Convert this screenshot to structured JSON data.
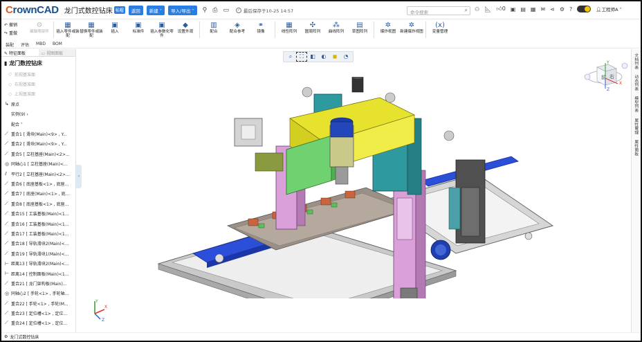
{
  "app": {
    "logo_first": "C",
    "logo_rest": "rownCAD",
    "doc_title": "龙门式数控钻床",
    "doc_tag": "帖帽"
  },
  "titlebar": {
    "btn_share": "返回",
    "btn_new": "新建 ˅",
    "btn_import_export": "导入/导出 ˅",
    "icon_pin": "pin-icon",
    "icon_print": "print-icon",
    "icon_save": "save-icon",
    "save_status": "最后保存于10-25 14:57",
    "search_placeholder": "命令搜索",
    "user_name": "工程师A ˅"
  },
  "ribbon": {
    "undo": "撤销",
    "redo": "重做",
    "items": [
      {
        "label": "编辑零部件",
        "icon": "⚙",
        "disabled": true
      },
      {
        "label": "插入零件或装配",
        "icon": "▦",
        "disabled": false
      },
      {
        "label": "替换零件或装配",
        "icon": "▦",
        "disabled": false
      },
      {
        "label": "插入",
        "icon": "▣",
        "disabled": false
      },
      {
        "label": "标准件",
        "icon": "▣",
        "disabled": false
      },
      {
        "label": "插入参数化零件",
        "icon": "▣",
        "disabled": false
      },
      {
        "label": "设置外观",
        "icon": "◆",
        "disabled": false
      },
      {
        "label": "配合",
        "icon": "▥",
        "disabled": false
      },
      {
        "label": "配合参考",
        "icon": "◈",
        "disabled": false
      },
      {
        "label": "镜像",
        "icon": "⚭",
        "disabled": false
      },
      {
        "label": "线性阵列",
        "icon": "▦",
        "disabled": false
      },
      {
        "label": "圆周阵列",
        "icon": "✣",
        "disabled": false
      },
      {
        "label": "曲线阵列",
        "icon": "⁂",
        "disabled": false
      },
      {
        "label": "草图阵列",
        "icon": "▤",
        "disabled": false
      },
      {
        "label": "爆炸视图",
        "icon": "✲",
        "disabled": false
      },
      {
        "label": "新建爆炸视图",
        "icon": "✲",
        "disabled": false
      },
      {
        "label": "变量管理",
        "icon": "(x)",
        "disabled": false
      }
    ]
  },
  "tabs": [
    "装配",
    "评估",
    "MBD",
    "BOM"
  ],
  "left_panel": {
    "tab_feature": "特征面板",
    "tab_view": "视图面板",
    "root": "龙门数控钻床",
    "rows": [
      {
        "label": "前视基准面",
        "dim": true,
        "icon": "◇"
      },
      {
        "label": "右视基准面",
        "dim": true,
        "icon": "◇"
      },
      {
        "label": "上视基准面",
        "dim": true,
        "icon": "◇"
      },
      {
        "label": "原点",
        "dim": false,
        "icon": "↳"
      },
      {
        "label": "实例(9) ›",
        "dim": false,
        "icon": ""
      },
      {
        "label": "配合 ˅",
        "dim": false,
        "icon": ""
      },
      {
        "label": "重合1 [ 滑块(Main)<9> , Y...",
        "dim": false,
        "icon": "⟋"
      },
      {
        "label": "重合2 [ 滑块(Main)<9> , Y...",
        "dim": false,
        "icon": "⟋"
      },
      {
        "label": "重合5 [ 立柱基座(Main)<2>...",
        "dim": false,
        "icon": "⟋"
      },
      {
        "label": "同轴心1 [ 立柱基座(Main)<...",
        "dim": false,
        "icon": "◎"
      },
      {
        "label": "平行2 [ 立柱基座(Main)<2>...",
        "dim": false,
        "icon": "⫽"
      },
      {
        "label": "重合6 [ 底座基板<1> , 底座...",
        "dim": false,
        "icon": "⟋"
      },
      {
        "label": "重合7 [ 底座(Main)<1> , 底...",
        "dim": false,
        "icon": "⟋"
      },
      {
        "label": "重合8 [ 底座基板<1> , 底座...",
        "dim": false,
        "icon": "⟋"
      },
      {
        "label": "重合15 [ 工装基板(Main)<1...",
        "dim": false,
        "icon": "⟋"
      },
      {
        "label": "重合16 [ 工装基板(Main)<1...",
        "dim": false,
        "icon": "⟋"
      },
      {
        "label": "重合17 [ 工装基板(Main)<1...",
        "dim": false,
        "icon": "⟋"
      },
      {
        "label": "重合18 [ 导轨滑块2(Main)<...",
        "dim": false,
        "icon": "⟋"
      },
      {
        "label": "重合19 [ 导轨滑块1(Main)<...",
        "dim": false,
        "icon": "⟋"
      },
      {
        "label": "距离13 [ 导轨滑块2(Main)<...",
        "dim": false,
        "icon": "⊢"
      },
      {
        "label": "距离14 [ 控制面板(Main)<1...",
        "dim": false,
        "icon": "⊢"
      },
      {
        "label": "重合21 [ 龙门架构板(Main)...",
        "dim": false,
        "icon": "⟋"
      },
      {
        "label": "同轴心2 [ 手轮<1> , 手轮轴...",
        "dim": false,
        "icon": "◎"
      },
      {
        "label": "重合22 [ 手轮<1> , 手轮(M...",
        "dim": false,
        "icon": "⟋"
      },
      {
        "label": "重合23 [ 定位槽<1> , 定位...",
        "dim": false,
        "icon": "⟋"
      },
      {
        "label": "重合24 [ 定位槽<1> , 定位...",
        "dim": false,
        "icon": "⟋"
      }
    ]
  },
  "statusbar": {
    "doc": "龙门式数控钻床"
  },
  "right_panel": [
    "文档列表",
    "动态列表",
    "模型列表",
    "属性管理",
    "属性面板"
  ],
  "view_cube": {
    "label_front": "前",
    "label_right": "右",
    "label_top": "上"
  },
  "triad": {
    "x": "X",
    "y": "Y",
    "z": "Z"
  }
}
